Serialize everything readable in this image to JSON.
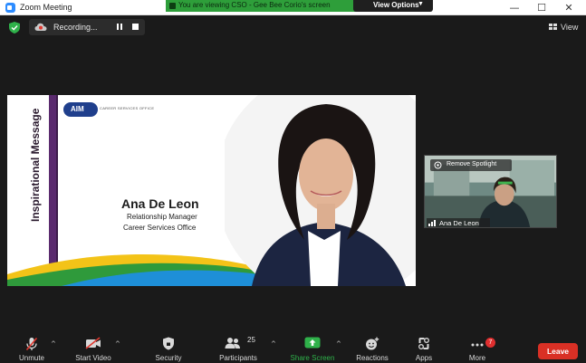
{
  "window": {
    "title": "Zoom Meeting",
    "controls": {
      "minimize": "—",
      "maximize": "☐",
      "close": "✕"
    }
  },
  "banner": {
    "text": "You are viewing CSO - Gee Bee Corio's screen",
    "view_options_label": "View Options",
    "color": "#2e9e3a"
  },
  "meeting_bar": {
    "recording_label": "Recording...",
    "view_label": "View"
  },
  "slide": {
    "side_heading": "Inspirational Message",
    "logo_text": "AIM",
    "office_header": "CAREER SERVICES OFFICE",
    "person_name": "Ana De Leon",
    "role_line1": "Relationship Manager",
    "role_line2": "Career Services Office",
    "accent_color": "#5a2a6e"
  },
  "spotlight": {
    "tag_label": "Remove Spotlight",
    "participant_name": "Ana De Leon"
  },
  "toolbar": {
    "unmute": "Unmute",
    "start_video": "Start Video",
    "security": "Security",
    "participants": "Participants",
    "participants_count": "25",
    "share_screen": "Share Screen",
    "reactions": "Reactions",
    "apps": "Apps",
    "more": "More",
    "more_badge": "7",
    "leave": "Leave",
    "share_color": "#2fb14a",
    "leave_color": "#d93025"
  }
}
